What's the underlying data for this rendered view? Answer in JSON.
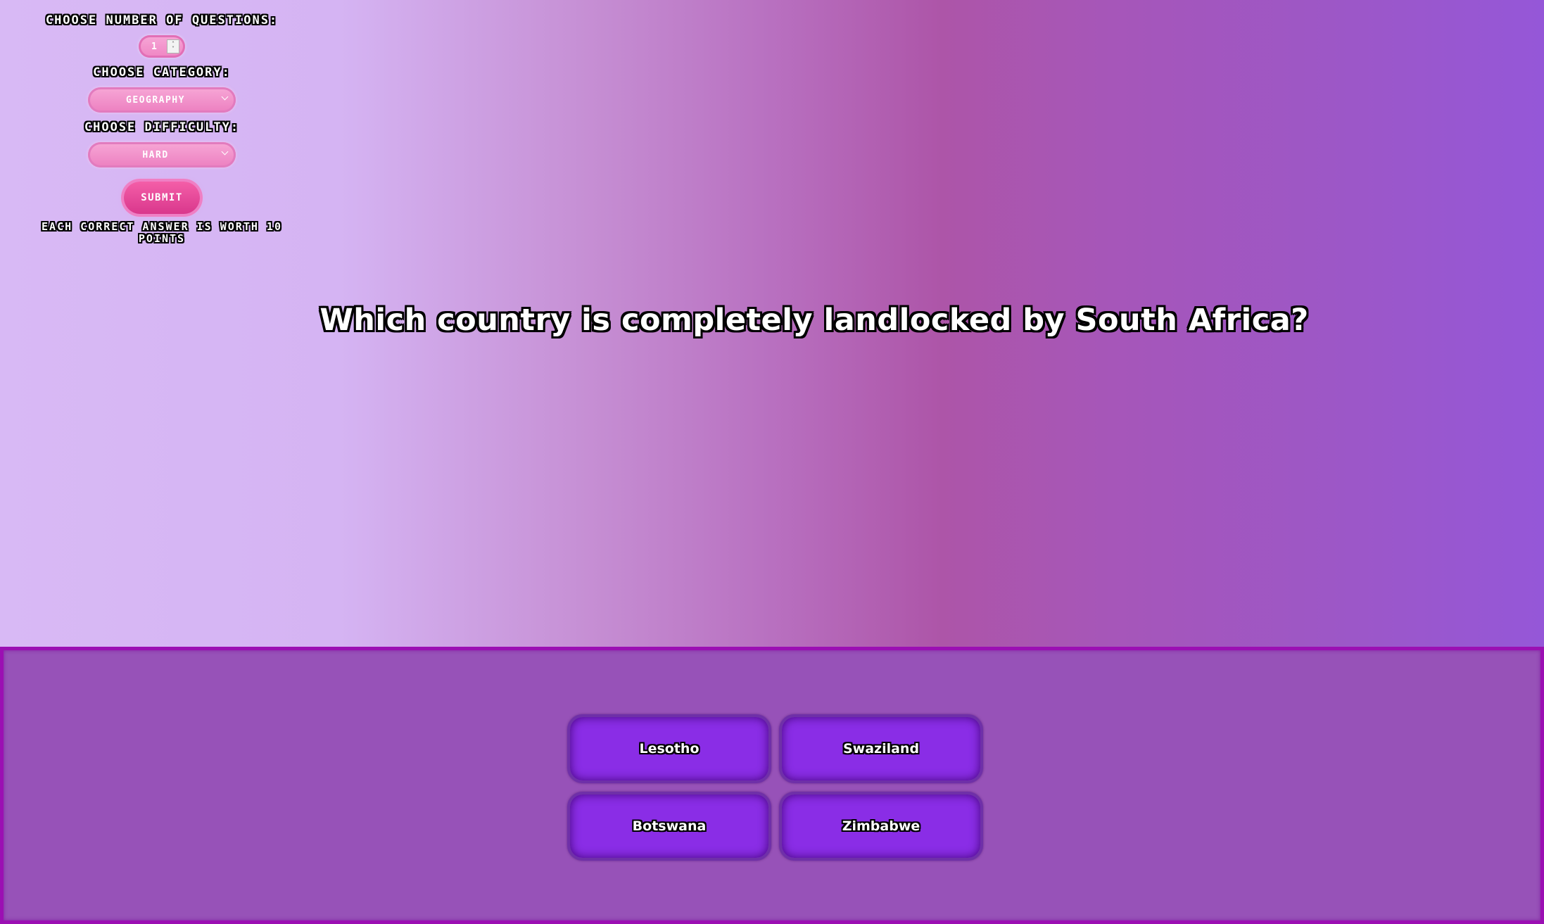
{
  "settings": {
    "number_label": "Choose Number of Questions:",
    "number_value": "1",
    "category_label": "Choose Category:",
    "category_value": "Geography",
    "difficulty_label": "Choose Difficulty:",
    "difficulty_value": "Hard",
    "submit_label": "Submit",
    "points_note": "Each correct answer is worth 10 points"
  },
  "question": {
    "text": "Which country is completely landlocked by South Africa?"
  },
  "answers": [
    {
      "label": "Lesotho"
    },
    {
      "label": "Swaziland"
    },
    {
      "label": "Botswana"
    },
    {
      "label": "Zimbabwe"
    }
  ],
  "colors": {
    "answer_button": "#8a2de6",
    "answer_panel": "#9752b8",
    "panel_border": "#9b0fb3",
    "submit_button": "#e2449a",
    "select_pink": "#ef85c3"
  }
}
